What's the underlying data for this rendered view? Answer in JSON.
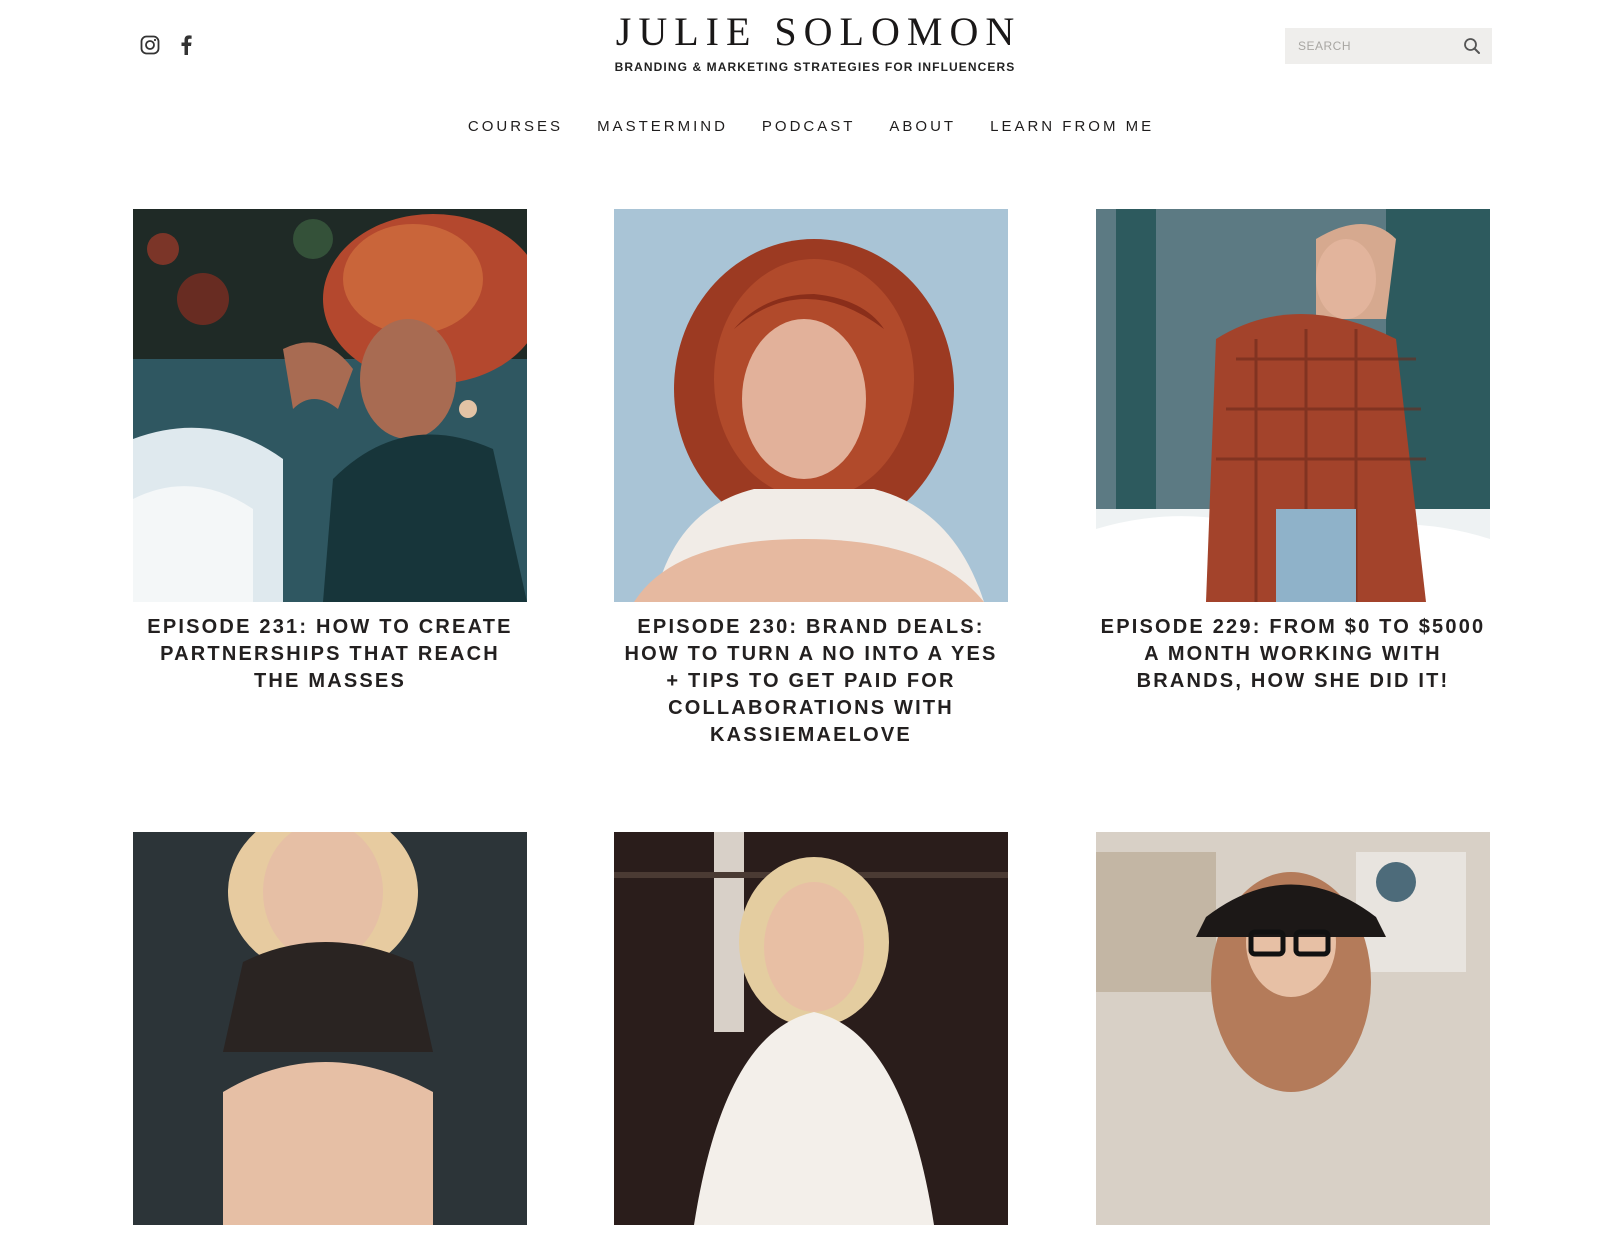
{
  "header": {
    "brand_name": "JULIE SOLOMON",
    "tagline": "BRANDING & MARKETING STRATEGIES FOR INFLUENCERS",
    "social_icons": [
      "instagram-icon",
      "facebook-icon"
    ],
    "search": {
      "placeholder": "SEARCH",
      "value": "",
      "icon": "search-icon"
    }
  },
  "nav": {
    "items": [
      {
        "label": "COURSES"
      },
      {
        "label": "MASTERMIND"
      },
      {
        "label": "PODCAST"
      },
      {
        "label": "ABOUT"
      },
      {
        "label": "LEARN FROM ME"
      }
    ]
  },
  "posts": [
    {
      "title": "EPISODE 231: HOW TO CREATE PARTNERSHIPS THAT REACH THE MASSES"
    },
    {
      "title": "EPISODE 230: BRAND DEALS: HOW TO TURN A NO INTO A YES + TIPS TO GET PAID FOR COLLABORATIONS WITH KASSIEMAELOVE"
    },
    {
      "title": "EPISODE 229: FROM $0 TO $5000 A MONTH WORKING WITH BRANDS, HOW SHE DID IT!"
    },
    {
      "title": ""
    },
    {
      "title": ""
    },
    {
      "title": ""
    }
  ],
  "colors": {
    "text": "#1f1d1d",
    "search_bg": "#efeeec",
    "photo_1_bg": "#2f5761",
    "photo_2_bg": "#a9c4d6",
    "photo_3_bg": "#2d5a5e",
    "photo_4_bg": "#2c3438",
    "photo_5_bg": "#2a1d1b",
    "photo_6_bg": "#d8d0c6"
  }
}
